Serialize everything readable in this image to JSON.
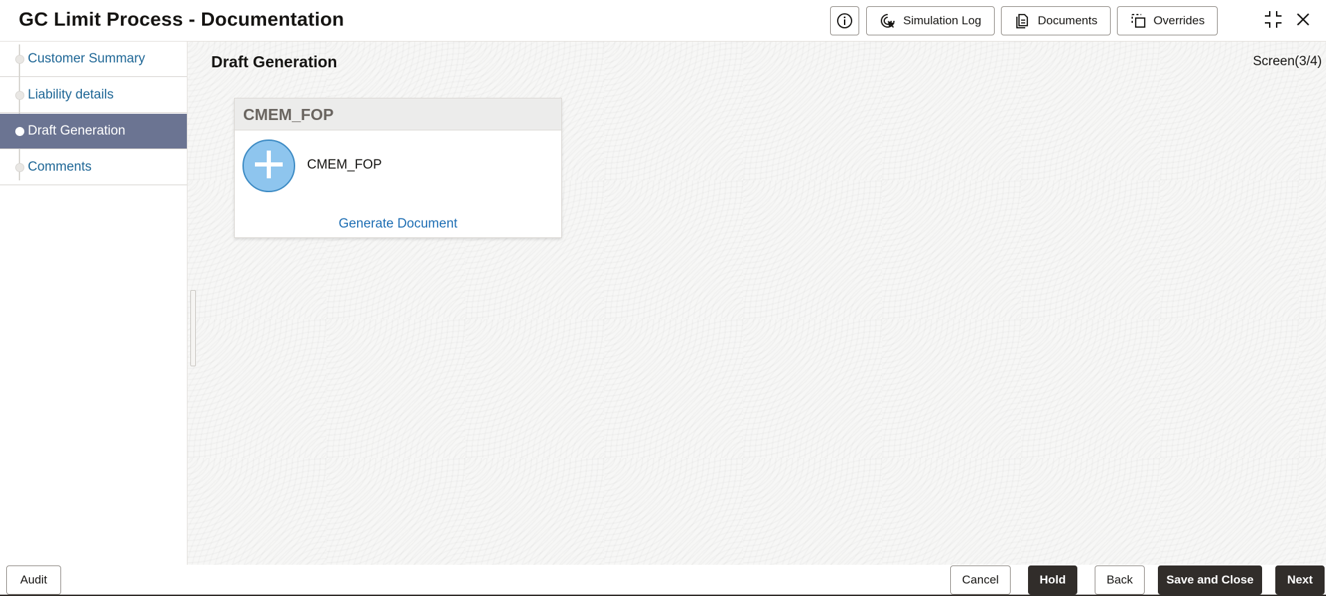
{
  "header": {
    "title": "GC Limit Process - Documentation",
    "buttons": {
      "simulation_log": "Simulation Log",
      "documents": "Documents",
      "overrides": "Overrides"
    }
  },
  "sidebar": {
    "items": [
      {
        "label": "Customer Summary",
        "active": false
      },
      {
        "label": "Liability details",
        "active": false
      },
      {
        "label": "Draft Generation",
        "active": true
      },
      {
        "label": "Comments",
        "active": false
      }
    ]
  },
  "main": {
    "section_title": "Draft Generation",
    "screen_indicator": "Screen(3/4)",
    "document_card": {
      "header": "CMEM_FOP",
      "document_name": "CMEM_FOP",
      "action_link": "Generate Document"
    }
  },
  "footer": {
    "audit": "Audit",
    "cancel": "Cancel",
    "hold": "Hold",
    "back": "Back",
    "save_and_close": "Save and Close",
    "next": "Next"
  },
  "colors": {
    "nav_active_bg": "#6b7492",
    "link_blue": "#1f6796",
    "primary_dark": "#312d2a",
    "plus_circle": "#8ec5ee"
  }
}
